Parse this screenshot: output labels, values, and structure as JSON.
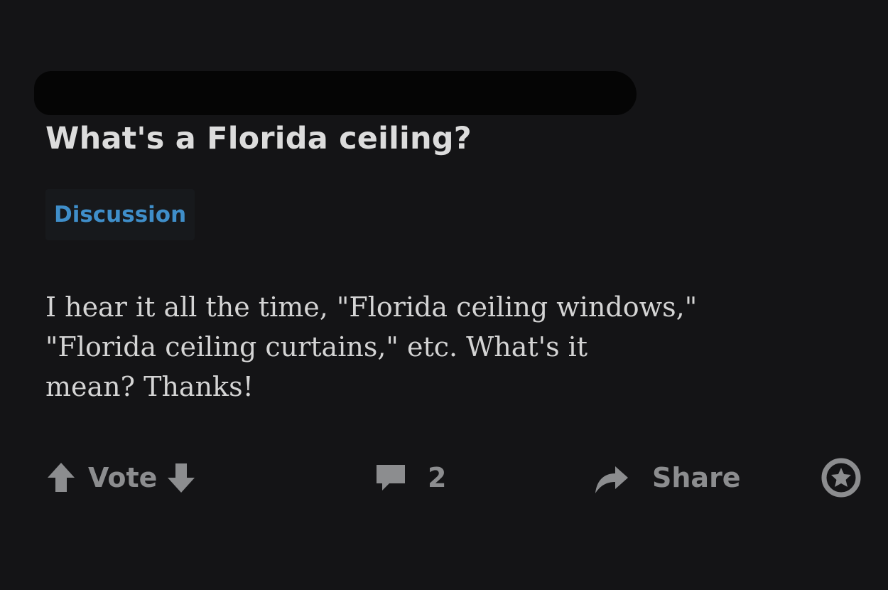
{
  "post": {
    "title": "What's a Florida ceiling?",
    "flair": "Discussion",
    "body_lines": [
      "I hear it all the time, \"Florida ceiling windows,\"",
      "\"Florida ceiling curtains,\" etc. What's it",
      "mean? Thanks!"
    ]
  },
  "actions": {
    "vote_label": "Vote",
    "comment_count": "2",
    "share_label": "Share"
  },
  "icons": {
    "upvote": "arrow-up-icon",
    "downvote": "arrow-down-icon",
    "comment": "comment-icon",
    "share": "share-arrow-icon",
    "award": "award-icon"
  },
  "colors": {
    "background": "#141416",
    "title": "#dcdcdc",
    "flair_text": "#3f8ec9",
    "action_gray": "#8c8d8f"
  }
}
